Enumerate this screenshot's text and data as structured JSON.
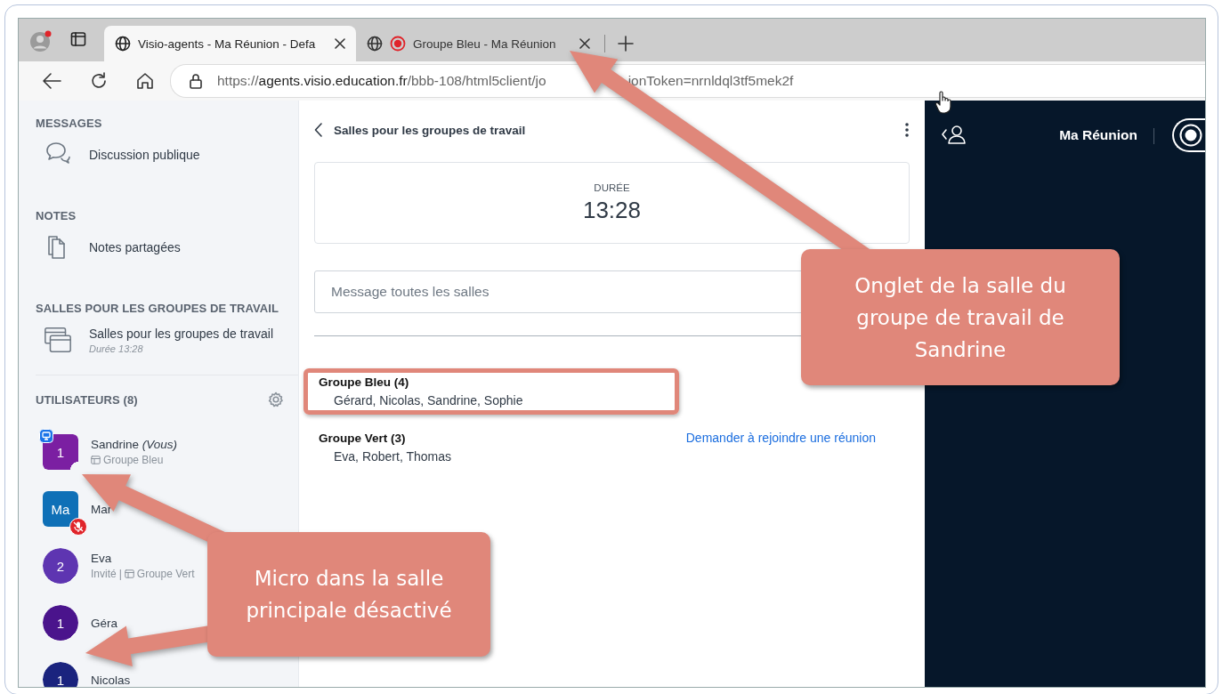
{
  "browser": {
    "tabs": [
      {
        "title": "Visio-agents - Ma Réunion - Defa",
        "selected": true,
        "recording": false
      },
      {
        "title": "Groupe Bleu - Ma Réunion",
        "selected": false,
        "recording": true
      }
    ],
    "url_parts": [
      {
        "kind": "scheme",
        "text": "https://"
      },
      {
        "kind": "host",
        "text": "agents.visio.education.fr"
      },
      {
        "kind": "path",
        "text": "/bbb-108/html5client/jo"
      },
      {
        "kind": "path_after_arrow",
        "text": "ionToken=nrnldql3tf5mek2f"
      }
    ]
  },
  "sidebar": {
    "sections": [
      {
        "heading": "MESSAGES",
        "items": [
          {
            "kind": "chat",
            "label": "Discussion publique"
          }
        ]
      },
      {
        "heading": "NOTES",
        "items": [
          {
            "kind": "notes",
            "label": "Notes partagées"
          }
        ]
      },
      {
        "heading": "SALLES POUR LES GROUPES DE TRAVAIL",
        "items": [
          {
            "kind": "breakout",
            "label": "Salles pour les groupes de travail",
            "sublabel": "Durée 13:28"
          }
        ]
      }
    ],
    "users_heading": "UTILISATEURS (8)",
    "users": [
      {
        "name": "Sandrine *(Vous)*",
        "avatar": "1",
        "kind": "moderator",
        "color": "#7b1fa2",
        "presenter": true,
        "muted": false,
        "notch": true,
        "room": "Groupe Bleu"
      },
      {
        "name": "Mar",
        "avatar": "Ma",
        "kind": "moderator",
        "color": "#0f70b7",
        "presenter": false,
        "muted": true,
        "notch": false
      },
      {
        "name": "Eva",
        "avatar": "2",
        "kind": "viewer",
        "color": "#5e35b1",
        "presenter": false,
        "muted": false,
        "notch": true,
        "role": "Invité",
        "separator": "|",
        "room": "Groupe Vert"
      },
      {
        "name": "Géra",
        "avatar": "1",
        "kind": "viewer",
        "color": "#4a148c",
        "presenter": false,
        "muted": false,
        "notch": true
      },
      {
        "name": "Nicolas",
        "avatar": "1",
        "kind": "viewer",
        "color": "#1a237e",
        "presenter": false,
        "muted": false,
        "notch": true
      }
    ]
  },
  "rooms_panel": {
    "title": "Salles pour les groupes de travail",
    "duration_label": "DURÉE",
    "duration": "13:28",
    "message_placeholder": "Message toutes les salles",
    "rooms": [
      {
        "name": "Groupe Bleu (4)",
        "members": "Gérard, Nicolas, Sandrine, Sophie",
        "highlighted": true
      },
      {
        "name": "Groupe Vert (3)",
        "members": "Eva, Robert, Thomas",
        "highlighted": false,
        "action": "Demander à rejoindre une réunion"
      }
    ]
  },
  "meeting": {
    "title": "Ma Réunion"
  },
  "annotations": [
    {
      "text": "Onglet de la salle du groupe de travail de Sandrine"
    },
    {
      "text": "Micro dans la salle principale désactivé"
    }
  ]
}
